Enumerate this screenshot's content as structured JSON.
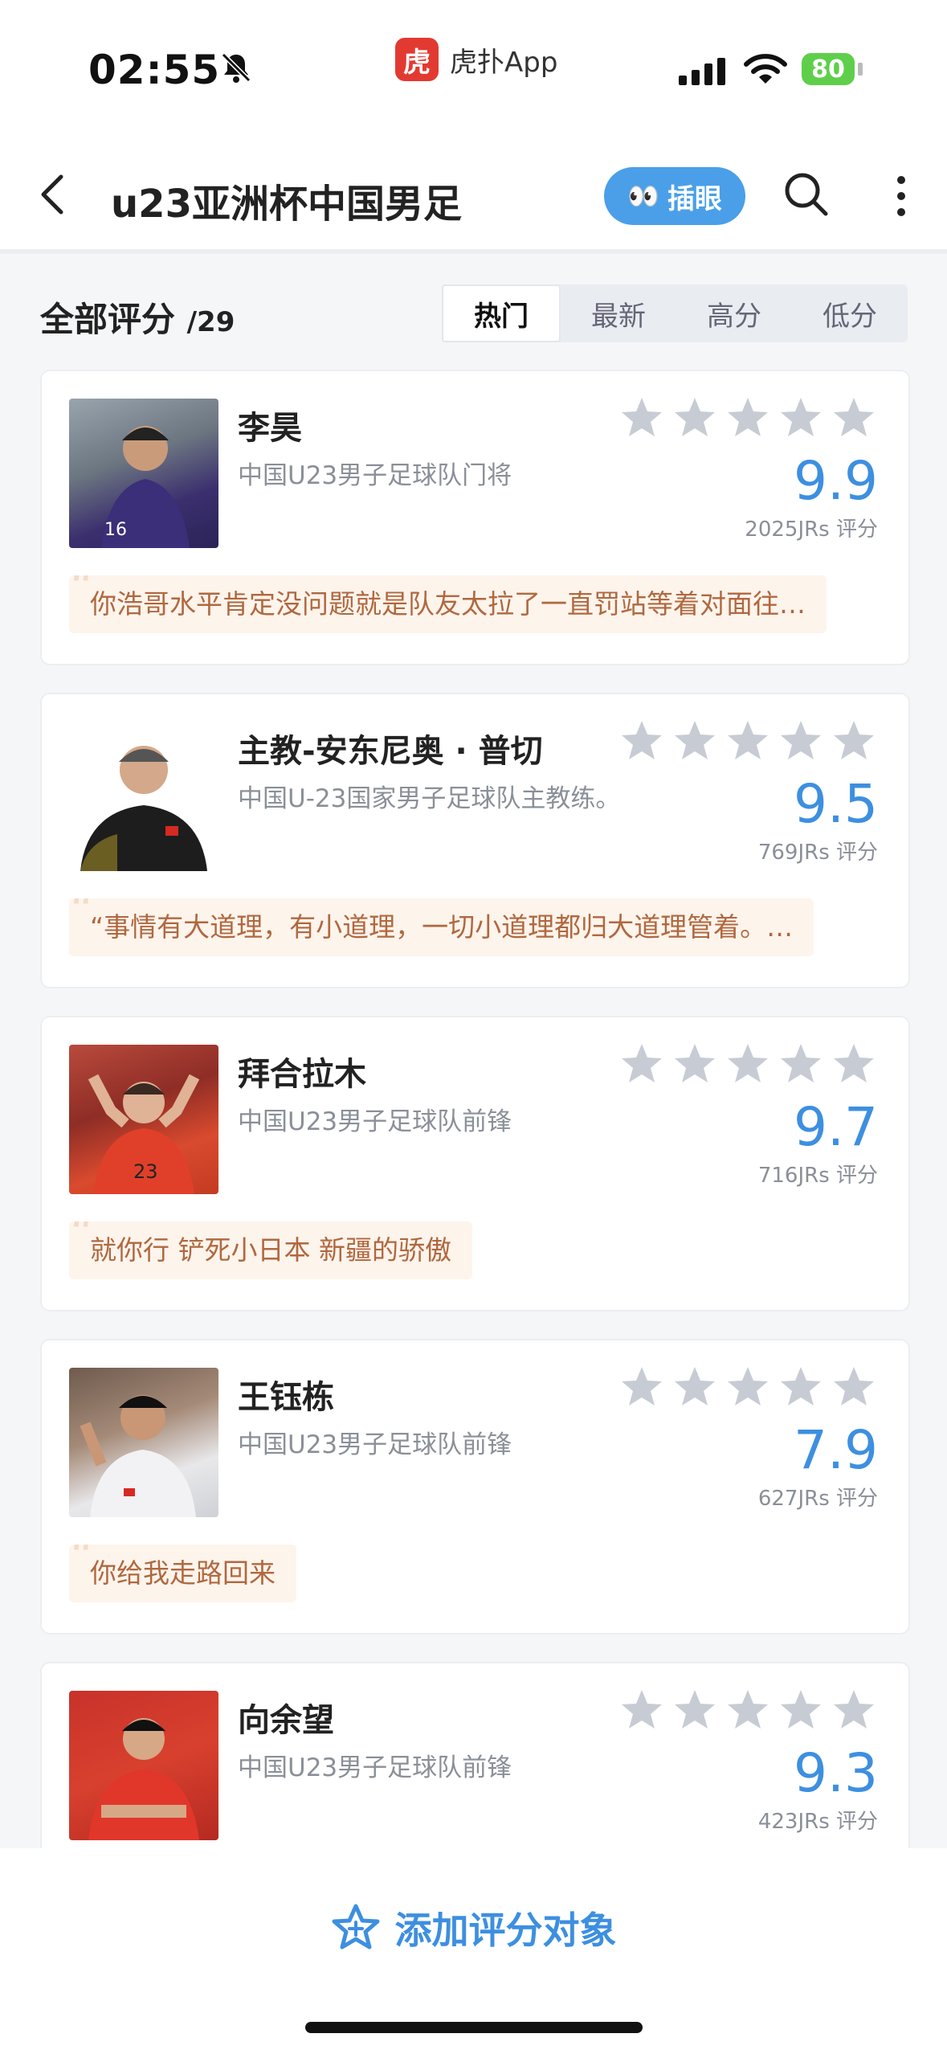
{
  "status_bar": {
    "time": "02:55",
    "app_name": "虎扑App",
    "app_logo_char": "虎",
    "battery": "80"
  },
  "nav": {
    "title": "u23亚洲杯中国男足",
    "pill_label": "插眼",
    "pill_emoji": "👀"
  },
  "filter": {
    "all_label": "全部评分",
    "count": "/29",
    "tabs": [
      "热门",
      "最新",
      "高分",
      "低分"
    ],
    "active_tab": "热门"
  },
  "accent_color": "#3d8fe0",
  "items": [
    {
      "name": "李昊",
      "desc": "中国U23男子足球队门将",
      "score": "9.9",
      "raters": "2025JRs 评分",
      "comment": "你浩哥水平肯定没问题就是队友太拉了一直罚站等着对面往…"
    },
    {
      "name": "主教-安东尼奥 · 普切",
      "desc": "中国U-23国家男子足球队主教练。",
      "score": "9.5",
      "raters": "769JRs 评分",
      "comment": "“事情有大道理，有小道理，一切小道理都归大道理管着。…"
    },
    {
      "name": "拜合拉木",
      "desc": "中国U23男子足球队前锋",
      "score": "9.7",
      "raters": "716JRs 评分",
      "comment": "就你行  铲死小日本  新疆的骄傲"
    },
    {
      "name": "王钰栋",
      "desc": "中国U23男子足球队前锋",
      "score": "7.9",
      "raters": "627JRs 评分",
      "comment": "你给我走路回来"
    },
    {
      "name": "向余望",
      "desc": "中国U23男子足球队前锋",
      "score": "9.3",
      "raters": "423JRs 评分",
      "comment": ""
    }
  ],
  "bottom": {
    "add_label": "添加评分对象"
  }
}
